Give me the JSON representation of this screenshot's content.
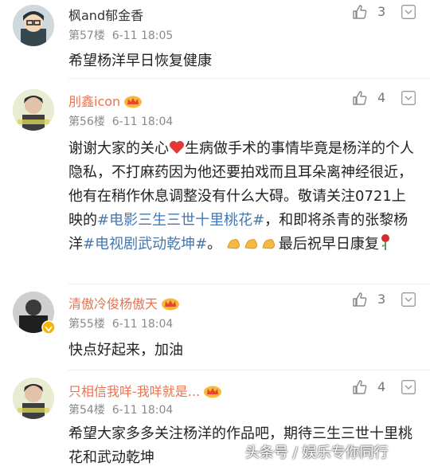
{
  "comments": [
    {
      "username": "枫and郁金香",
      "floor": "第57楼",
      "date": "6-11 18:05",
      "text": "希望杨洋早日恢复健康",
      "likes": "3",
      "avatar_icon": "cartoon-boy-avatar"
    },
    {
      "username": "刖鑫icon",
      "floor": "第56楼",
      "date": "6-11 18:04",
      "text_parts": {
        "p1": "谢谢大家的关心",
        "p2": "生病做手术的事情毕竟是杨洋的个人隐私，不打麻药因为他还要拍戏而且耳朵离神经很近，他有在稍作休息调整没有什么大碍。敬请关注0721上映的",
        "topic1": "#电影三生三世十里桃花#",
        "p3": "，和即将杀青的张黎杨洋",
        "topic2": "#电视剧武动乾坤#",
        "p4": "。",
        "p5": "最后祝早日康复"
      },
      "likes": "4",
      "avatar_icon": "photo-avatar"
    },
    {
      "username": "清傲冷俊杨傲天",
      "floor": "第55楼",
      "date": "6-11 18:04",
      "text": "快点好起来，加油",
      "likes": "3",
      "avatar_icon": "dark-photo-avatar"
    },
    {
      "username": "只相信我咩-我咩就是...",
      "floor": "第54楼",
      "date": "6-11 18:04",
      "text": "希望大家多多关注杨洋的作品吧，期待三生三世十里桃花和武动乾坤",
      "likes": "4",
      "avatar_icon": "photo-avatar"
    }
  ],
  "watermark": "头条号 / 娱乐专你同行",
  "colors": {
    "orange_name": "#eb7350",
    "topic": "#4078b4",
    "crown": "#f5a623"
  },
  "icons": [
    "thumbs-up-icon",
    "more-chevron-icon",
    "crown-icon",
    "heart-emoji",
    "flexed-biceps-emoji",
    "rose-emoji",
    "vip-badge-icon"
  ]
}
